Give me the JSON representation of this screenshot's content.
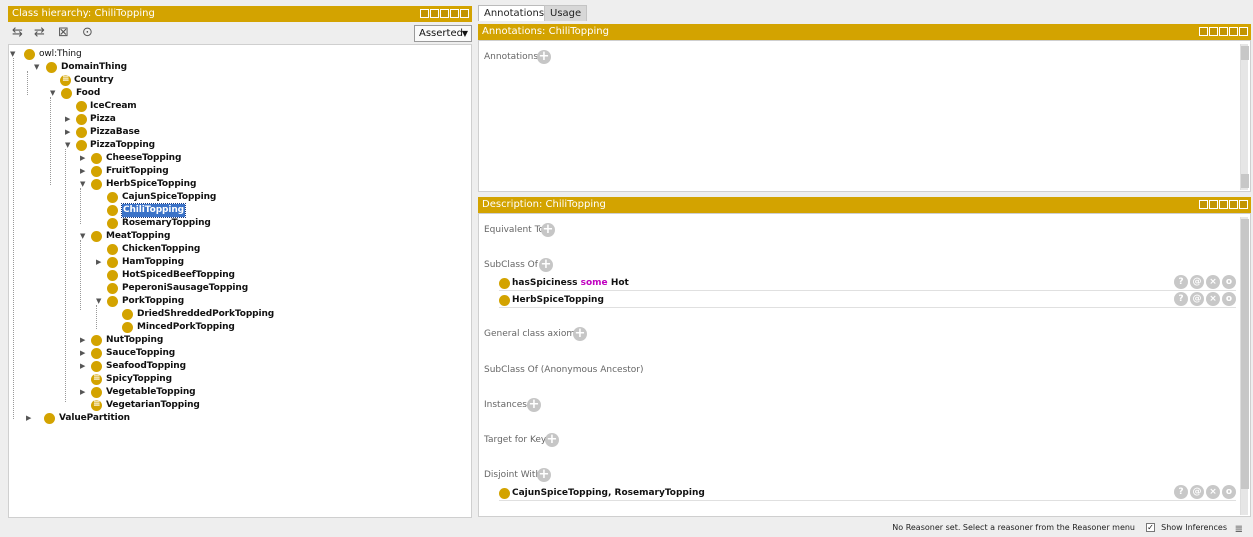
{
  "left_panel": {
    "title": "Class hierarchy: ChiliTopping",
    "dropdown_value": "Asserted"
  },
  "tree": [
    {
      "label": "owl:Thing",
      "plain": true
    },
    {
      "label": "DomainThing"
    },
    {
      "label": "Country"
    },
    {
      "label": "Food"
    },
    {
      "label": "IceCream"
    },
    {
      "label": "Pizza"
    },
    {
      "label": "PizzaBase"
    },
    {
      "label": "PizzaTopping"
    },
    {
      "label": "CheeseTopping"
    },
    {
      "label": "FruitTopping"
    },
    {
      "label": "HerbSpiceTopping"
    },
    {
      "label": "CajunSpiceTopping"
    },
    {
      "label": "ChiliTopping"
    },
    {
      "label": "RosemaryTopping"
    },
    {
      "label": "MeatTopping"
    },
    {
      "label": "ChickenTopping"
    },
    {
      "label": "HamTopping"
    },
    {
      "label": "HotSpicedBeefTopping"
    },
    {
      "label": "PeperoniSausageTopping"
    },
    {
      "label": "PorkTopping"
    },
    {
      "label": "DriedShreddedPorkTopping"
    },
    {
      "label": "MincedPorkTopping"
    },
    {
      "label": "NutTopping"
    },
    {
      "label": "SauceTopping"
    },
    {
      "label": "SeafoodTopping"
    },
    {
      "label": "SpicyTopping"
    },
    {
      "label": "VegetableTopping"
    },
    {
      "label": "VegetarianTopping"
    },
    {
      "label": "ValuePartition"
    }
  ],
  "tabs": {
    "annotations": "Annotations",
    "usage": "Usage"
  },
  "annotations_panel": {
    "title": "Annotations: ChiliTopping",
    "label": "Annotations"
  },
  "description_panel": {
    "title": "Description: ChiliTopping",
    "equivalent_to": "Equivalent To",
    "subclass_of": "SubClass Of",
    "subclass_items": [
      {
        "property": "hasSpiciness",
        "keyword": "some",
        "filler": "Hot"
      },
      {
        "text": "HerbSpiceTopping"
      }
    ],
    "general_class_axioms": "General class axioms",
    "subclass_anon": "SubClass Of (Anonymous Ancestor)",
    "instances": "Instances",
    "target_for_key": "Target for Key",
    "disjoint_with": "Disjoint With",
    "disjoint_items": [
      {
        "text": "CajunSpiceTopping, RosemaryTopping"
      }
    ]
  },
  "status_bar": {
    "message": "No Reasoner set. Select a reasoner from the Reasoner menu",
    "show_inferences": "Show Inferences"
  },
  "colors": {
    "header": "#d3a300",
    "selection": "#3b73c8",
    "keyword": "#c000c0"
  }
}
